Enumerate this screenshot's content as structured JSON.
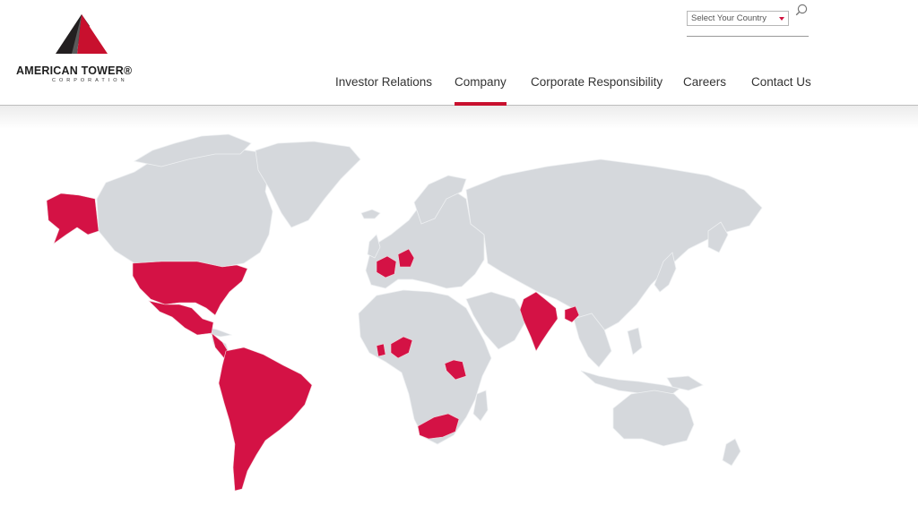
{
  "brand": {
    "name": "AMERICAN TOWER®",
    "subtitle": "CORPORATION"
  },
  "search": {
    "country_select_value": "Select Your Country",
    "icon": "search-icon"
  },
  "nav": {
    "items": [
      {
        "label": "Investor Relations",
        "active": false
      },
      {
        "label": "Company",
        "active": true
      },
      {
        "label": "Corporate Responsibility",
        "active": false
      },
      {
        "label": "Careers",
        "active": false
      },
      {
        "label": "Contact Us",
        "active": false
      }
    ]
  },
  "map": {
    "highlighted_regions": [
      "Alaska",
      "United States",
      "Mexico",
      "Central America",
      "South America",
      "France",
      "Germany",
      "Nigeria",
      "Ghana",
      "Kenya",
      "Uganda",
      "South Africa",
      "India",
      "Bangladesh"
    ]
  },
  "colors": {
    "accent": "#c8102e",
    "land": "#d5d8dc",
    "highlight": "#d41245",
    "text": "#333333"
  }
}
